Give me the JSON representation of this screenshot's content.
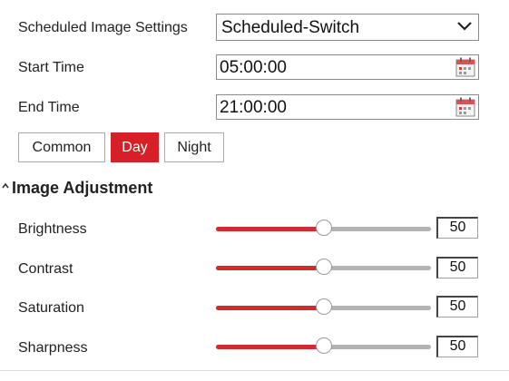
{
  "schedule": {
    "label": "Scheduled Image Settings",
    "value": "Scheduled-Switch",
    "start_label": "Start Time",
    "start_value": "05:00:00",
    "end_label": "End Time",
    "end_value": "21:00:00"
  },
  "mode_tabs": [
    {
      "label": "Common",
      "active": false
    },
    {
      "label": "Day",
      "active": true
    },
    {
      "label": "Night",
      "active": false
    }
  ],
  "image_adjustment": {
    "title": "Image Adjustment",
    "items": [
      {
        "label": "Brightness",
        "value": "50",
        "fraction": 0.5
      },
      {
        "label": "Contrast",
        "value": "50",
        "fraction": 0.5
      },
      {
        "label": "Saturation",
        "value": "50",
        "fraction": 0.5
      },
      {
        "label": "Sharpness",
        "value": "50",
        "fraction": 0.5
      }
    ]
  },
  "colors": {
    "accent": "#d71f27",
    "slider_fill": "#d12a2f",
    "slider_track": "#b3b3b3"
  },
  "icons": [
    "chevron-down-icon",
    "calendar-icon",
    "collapse-caret-icon"
  ]
}
